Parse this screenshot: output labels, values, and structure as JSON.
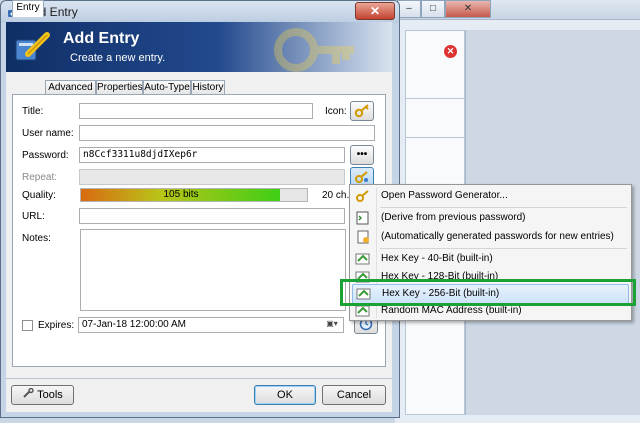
{
  "window": {
    "title": "Add Entry",
    "close_glyph": "✕"
  },
  "banner": {
    "title": "Add Entry",
    "subtitle": "Create a new entry."
  },
  "tabs": [
    {
      "label": "Entry",
      "active": true
    },
    {
      "label": "Advanced",
      "active": false
    },
    {
      "label": "Properties",
      "active": false
    },
    {
      "label": "Auto-Type",
      "active": false
    },
    {
      "label": "History",
      "active": false
    }
  ],
  "form": {
    "title_label": "Title:",
    "title_value": "",
    "icon_label": "Icon:",
    "username_label": "User name:",
    "username_value": "",
    "password_label": "Password:",
    "password_value": "n8Ccf3311u8djdIXep6r",
    "password_toggle": "•••",
    "repeat_label": "Repeat:",
    "quality_label": "Quality:",
    "quality_text": "105 bits",
    "quality_fraction": 0.88,
    "quality_chars": "20 ch.",
    "url_label": "URL:",
    "url_value": "",
    "notes_label": "Notes:",
    "expires_label": "Expires:",
    "expires_value": "07-Jan-18 12:00:00 AM",
    "expires_checked": false
  },
  "footer": {
    "tools_label": "Tools",
    "ok_label": "OK",
    "cancel_label": "Cancel"
  },
  "password_menu": {
    "items": [
      {
        "label": "Open Password Generator...",
        "icon": "key-icon"
      },
      {
        "label": "(Derive from previous password)",
        "icon": "terminal-icon"
      },
      {
        "label": "(Automatically generated passwords for new entries)",
        "icon": "document-icon"
      },
      {
        "label": "Hex Key - 40-Bit (built-in)",
        "icon": "profile-icon"
      },
      {
        "label": "Hex Key - 128-Bit (built-in)",
        "icon": "profile-icon"
      },
      {
        "label": "Hex Key - 256-Bit (built-in)",
        "icon": "profile-icon",
        "hovered": true
      },
      {
        "label": "Random MAC Address (built-in)",
        "icon": "profile-icon"
      }
    ]
  },
  "colors": {
    "highlight_box": "#1aa234",
    "banner_dark": "#0f2e66",
    "quality_start": "#d96a12",
    "quality_end": "#3fcf16"
  }
}
